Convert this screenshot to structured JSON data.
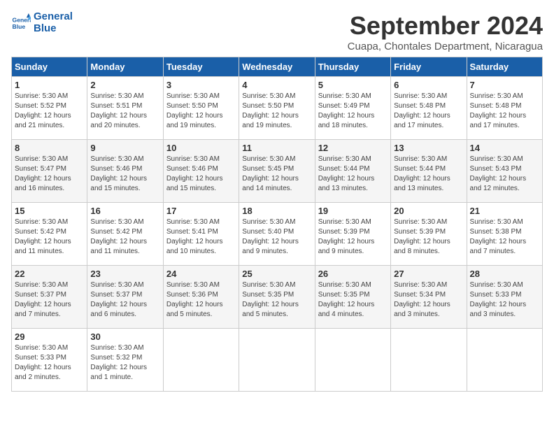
{
  "logo": {
    "line1": "General",
    "line2": "Blue"
  },
  "title": "September 2024",
  "subtitle": "Cuapa, Chontales Department, Nicaragua",
  "weekdays": [
    "Sunday",
    "Monday",
    "Tuesday",
    "Wednesday",
    "Thursday",
    "Friday",
    "Saturday"
  ],
  "weeks": [
    [
      {
        "day": "1",
        "sunrise": "5:30 AM",
        "sunset": "5:52 PM",
        "daylight": "12 hours and 21 minutes."
      },
      {
        "day": "2",
        "sunrise": "5:30 AM",
        "sunset": "5:51 PM",
        "daylight": "12 hours and 20 minutes."
      },
      {
        "day": "3",
        "sunrise": "5:30 AM",
        "sunset": "5:50 PM",
        "daylight": "12 hours and 19 minutes."
      },
      {
        "day": "4",
        "sunrise": "5:30 AM",
        "sunset": "5:50 PM",
        "daylight": "12 hours and 19 minutes."
      },
      {
        "day": "5",
        "sunrise": "5:30 AM",
        "sunset": "5:49 PM",
        "daylight": "12 hours and 18 minutes."
      },
      {
        "day": "6",
        "sunrise": "5:30 AM",
        "sunset": "5:48 PM",
        "daylight": "12 hours and 17 minutes."
      },
      {
        "day": "7",
        "sunrise": "5:30 AM",
        "sunset": "5:48 PM",
        "daylight": "12 hours and 17 minutes."
      }
    ],
    [
      {
        "day": "8",
        "sunrise": "5:30 AM",
        "sunset": "5:47 PM",
        "daylight": "12 hours and 16 minutes."
      },
      {
        "day": "9",
        "sunrise": "5:30 AM",
        "sunset": "5:46 PM",
        "daylight": "12 hours and 15 minutes."
      },
      {
        "day": "10",
        "sunrise": "5:30 AM",
        "sunset": "5:46 PM",
        "daylight": "12 hours and 15 minutes."
      },
      {
        "day": "11",
        "sunrise": "5:30 AM",
        "sunset": "5:45 PM",
        "daylight": "12 hours and 14 minutes."
      },
      {
        "day": "12",
        "sunrise": "5:30 AM",
        "sunset": "5:44 PM",
        "daylight": "12 hours and 13 minutes."
      },
      {
        "day": "13",
        "sunrise": "5:30 AM",
        "sunset": "5:44 PM",
        "daylight": "12 hours and 13 minutes."
      },
      {
        "day": "14",
        "sunrise": "5:30 AM",
        "sunset": "5:43 PM",
        "daylight": "12 hours and 12 minutes."
      }
    ],
    [
      {
        "day": "15",
        "sunrise": "5:30 AM",
        "sunset": "5:42 PM",
        "daylight": "12 hours and 11 minutes."
      },
      {
        "day": "16",
        "sunrise": "5:30 AM",
        "sunset": "5:42 PM",
        "daylight": "12 hours and 11 minutes."
      },
      {
        "day": "17",
        "sunrise": "5:30 AM",
        "sunset": "5:41 PM",
        "daylight": "12 hours and 10 minutes."
      },
      {
        "day": "18",
        "sunrise": "5:30 AM",
        "sunset": "5:40 PM",
        "daylight": "12 hours and 9 minutes."
      },
      {
        "day": "19",
        "sunrise": "5:30 AM",
        "sunset": "5:39 PM",
        "daylight": "12 hours and 9 minutes."
      },
      {
        "day": "20",
        "sunrise": "5:30 AM",
        "sunset": "5:39 PM",
        "daylight": "12 hours and 8 minutes."
      },
      {
        "day": "21",
        "sunrise": "5:30 AM",
        "sunset": "5:38 PM",
        "daylight": "12 hours and 7 minutes."
      }
    ],
    [
      {
        "day": "22",
        "sunrise": "5:30 AM",
        "sunset": "5:37 PM",
        "daylight": "12 hours and 7 minutes."
      },
      {
        "day": "23",
        "sunrise": "5:30 AM",
        "sunset": "5:37 PM",
        "daylight": "12 hours and 6 minutes."
      },
      {
        "day": "24",
        "sunrise": "5:30 AM",
        "sunset": "5:36 PM",
        "daylight": "12 hours and 5 minutes."
      },
      {
        "day": "25",
        "sunrise": "5:30 AM",
        "sunset": "5:35 PM",
        "daylight": "12 hours and 5 minutes."
      },
      {
        "day": "26",
        "sunrise": "5:30 AM",
        "sunset": "5:35 PM",
        "daylight": "12 hours and 4 minutes."
      },
      {
        "day": "27",
        "sunrise": "5:30 AM",
        "sunset": "5:34 PM",
        "daylight": "12 hours and 3 minutes."
      },
      {
        "day": "28",
        "sunrise": "5:30 AM",
        "sunset": "5:33 PM",
        "daylight": "12 hours and 3 minutes."
      }
    ],
    [
      {
        "day": "29",
        "sunrise": "5:30 AM",
        "sunset": "5:33 PM",
        "daylight": "12 hours and 2 minutes."
      },
      {
        "day": "30",
        "sunrise": "5:30 AM",
        "sunset": "5:32 PM",
        "daylight": "12 hours and 1 minute."
      },
      null,
      null,
      null,
      null,
      null
    ]
  ]
}
